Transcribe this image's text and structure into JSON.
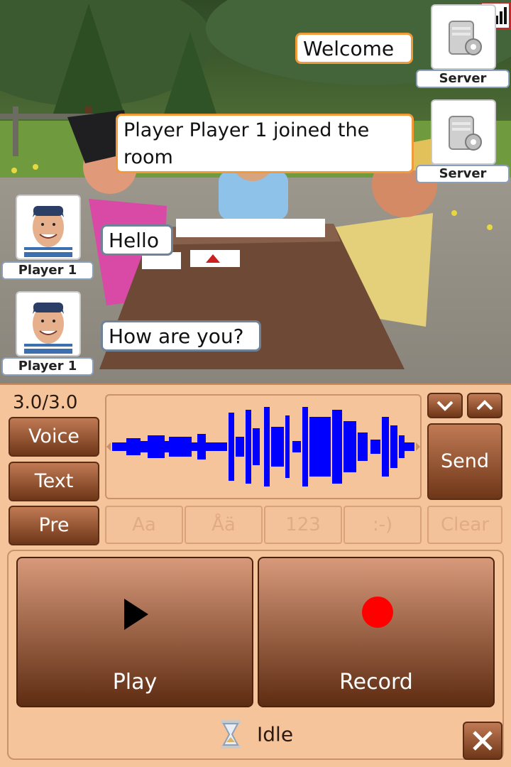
{
  "chat": {
    "messages": [
      {
        "sender": "Server",
        "text": "Welcome"
      },
      {
        "sender": "Server",
        "text_line1": "Player Player 1 joined the",
        "text_line2": "room"
      },
      {
        "sender": "Player 1",
        "text": "Hello"
      },
      {
        "sender": "Player 1",
        "text": "How are you?"
      }
    ]
  },
  "panel": {
    "counter": "3.0/3.0",
    "mode_buttons": {
      "voice": "Voice",
      "text": "Text",
      "pre": "Pre"
    },
    "send_label": "Send",
    "keyboard_tabs": [
      "Aa",
      "Åä",
      "123",
      ":-)"
    ],
    "clear_label": "Clear",
    "play_label": "Play",
    "record_label": "Record",
    "status": "Idle"
  },
  "icons": {
    "scroll_down": "chevron-down-icon",
    "scroll_up": "chevron-up-icon",
    "play": "play-icon",
    "record": "record-dot-icon",
    "status": "hourglass-icon",
    "close": "close-icon",
    "server": "server-gear-icon",
    "signal": "signal-strength-icon"
  },
  "colors": {
    "panel_bg": "#f5c49b",
    "button_brown": "#6e3618",
    "waveform": "#0000ff",
    "record_dot": "#ff0000",
    "server_bubble_border": "#f09a3a",
    "player_bubble_border": "#6f8398"
  }
}
